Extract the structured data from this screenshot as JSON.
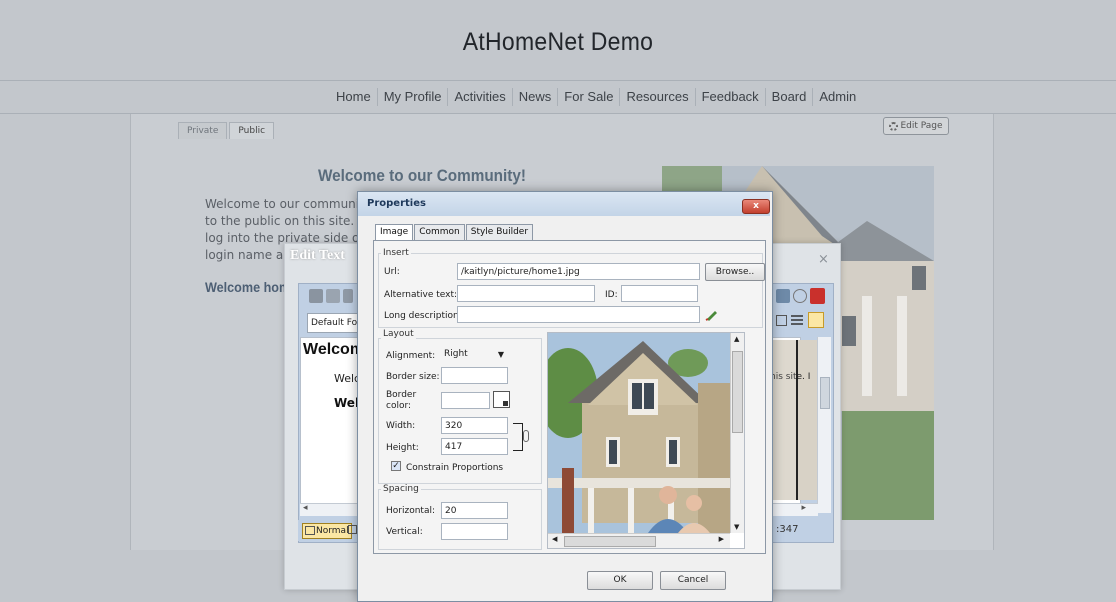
{
  "site": {
    "title": "AtHomeNet Demo",
    "nav": [
      "Home",
      "My Profile",
      "Activities",
      "News",
      "For Sale",
      "Resources",
      "Feedback",
      "Board",
      "Admin"
    ]
  },
  "page": {
    "tabs": [
      {
        "label": "Private",
        "active": false
      },
      {
        "label": "Public",
        "active": true
      }
    ],
    "edit_page_label": "Edit Page",
    "welcome_title": "Welcome to our Community!",
    "intro_lines": [
      "Welcome to our community",
      "to the public on this site. If y",
      "log into the private side of t",
      "login name ar"
    ],
    "welcome_home": "Welcome home"
  },
  "editor": {
    "title": "Edit Text",
    "close": "×",
    "font_select": "Default Fon",
    "content": {
      "heading": "Welcom",
      "line1": "Welc",
      "line2": "Wel",
      "right_text": "his site. I"
    },
    "mode_button": "Normal",
    "char_count": ":347"
  },
  "dialog": {
    "title": "Properties",
    "close": "x",
    "tabs": [
      {
        "label": "Image",
        "active": true
      },
      {
        "label": "Common",
        "active": false
      },
      {
        "label": "Style Builder",
        "active": false
      }
    ],
    "insert": {
      "legend": "Insert",
      "url_label": "Url:",
      "url_value": "/kaitlyn/picture/home1.jpg",
      "browse": "Browse..",
      "alt_label": "Alternative text:",
      "alt_value": "",
      "id_label": "ID:",
      "id_value": "",
      "longdesc_label": "Long description:",
      "longdesc_value": ""
    },
    "layout": {
      "legend": "Layout",
      "alignment_label": "Alignment:",
      "alignment_value": "Right",
      "border_size_label": "Border size:",
      "border_size_value": "",
      "border_color_label": "Border color:",
      "width_label": "Width:",
      "width_value": "320",
      "height_label": "Height:",
      "height_value": "417",
      "constrain_label": "Constrain Proportions",
      "constrain_checked": true
    },
    "spacing": {
      "legend": "Spacing",
      "horizontal_label": "Horizontal:",
      "horizontal_value": "20",
      "vertical_label": "Vertical:",
      "vertical_value": ""
    },
    "ok": "OK",
    "cancel": "Cancel"
  }
}
